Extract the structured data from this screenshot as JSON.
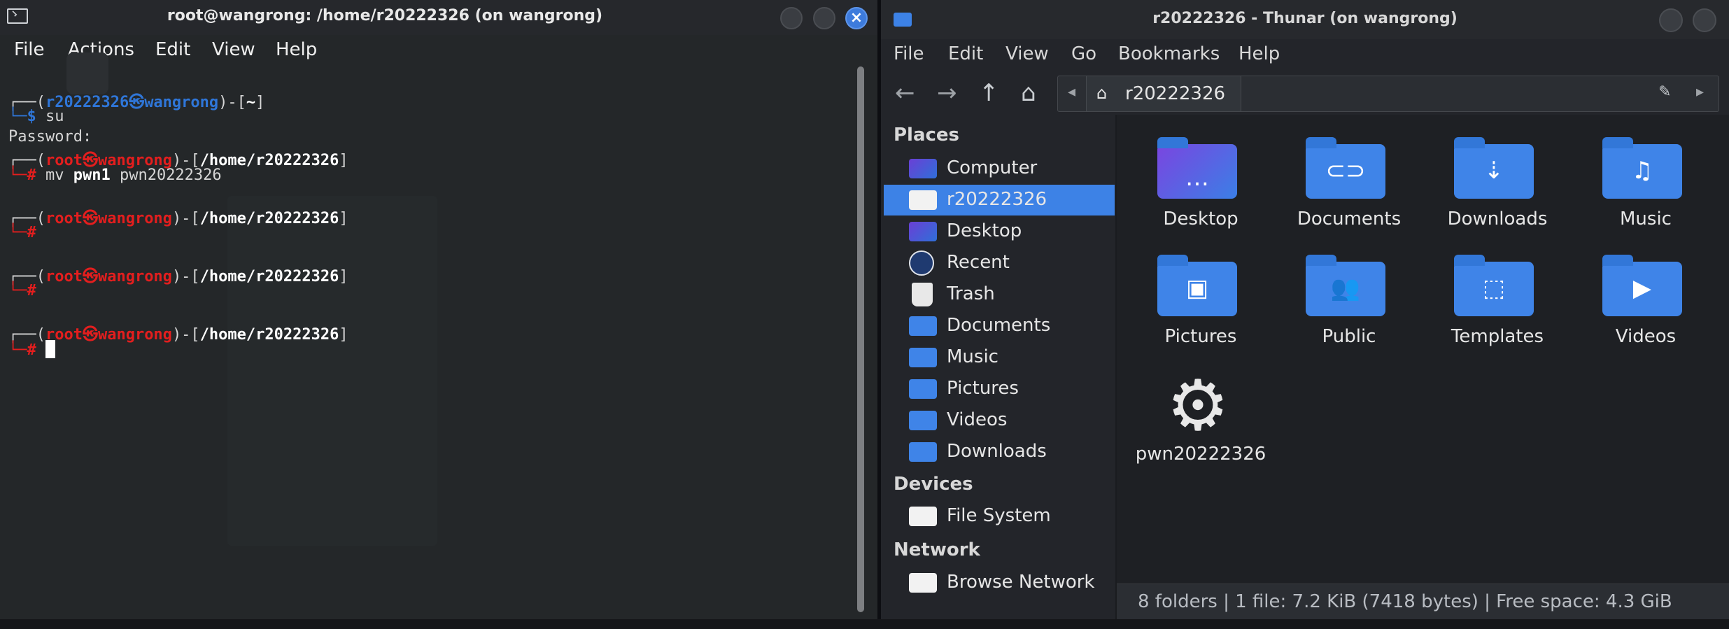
{
  "terminal": {
    "title": "root@wangrong: /home/r20222326 (on wangrong)",
    "close_glyph": "×",
    "menu": [
      "File",
      "Actions",
      "Edit",
      "View",
      "Help"
    ],
    "lines": [
      {
        "open": "┌──(",
        "user": "r20222326㉿wangrong",
        "close": ")-[",
        "path": "~",
        "end": "]"
      },
      {
        "prompt": "└─$ ",
        "cmd": "su"
      },
      {
        "text": "Password:"
      },
      {
        "open": "┌──(",
        "user": "root㉿wangrong",
        "close": ")-[",
        "path": "/home/r20222326",
        "end": "]"
      },
      {
        "prompt": "└─# ",
        "cmd_a": "mv ",
        "cmd_b": "pwn1",
        "cmd_c": " pwn20222326"
      },
      {
        "open": "┌──(",
        "user": "root㉿wangrong",
        "close": ")-[",
        "path": "/home/r20222326",
        "end": "]"
      },
      {
        "prompt": "└─#"
      },
      {
        "open": "┌──(",
        "user": "root㉿wangrong",
        "close": ")-[",
        "path": "/home/r20222326",
        "end": "]"
      },
      {
        "prompt": "└─#"
      },
      {
        "open": "┌──(",
        "user": "root㉿wangrong",
        "close": ")-[",
        "path": "/home/r20222326",
        "end": "]"
      },
      {
        "prompt": "└─# "
      }
    ]
  },
  "thunar": {
    "title": "r20222326 - Thunar (on wangrong)",
    "menu": [
      "File",
      "Edit",
      "View",
      "Go",
      "Bookmarks",
      "Help"
    ],
    "location": "r20222326",
    "sections": {
      "places": "Places",
      "devices": "Devices",
      "network": "Network"
    },
    "places": [
      "Computer",
      "r20222326",
      "Desktop",
      "Recent",
      "Trash",
      "Documents",
      "Music",
      "Pictures",
      "Videos",
      "Downloads"
    ],
    "devices": [
      "File System"
    ],
    "network": [
      "Browse Network"
    ],
    "items": [
      "Desktop",
      "Documents",
      "Downloads",
      "Music",
      "Pictures",
      "Public",
      "Templates",
      "Videos",
      "pwn20222326"
    ],
    "status": "8 folders | 1 file: 7.2 KiB (7418 bytes) | Free space: 4.3 GiB",
    "colors": {
      "accent": "#3d82e6",
      "folder": "#3f84e8",
      "root_red": "#e31e1e",
      "user_blue": "#2f76d8"
    }
  }
}
